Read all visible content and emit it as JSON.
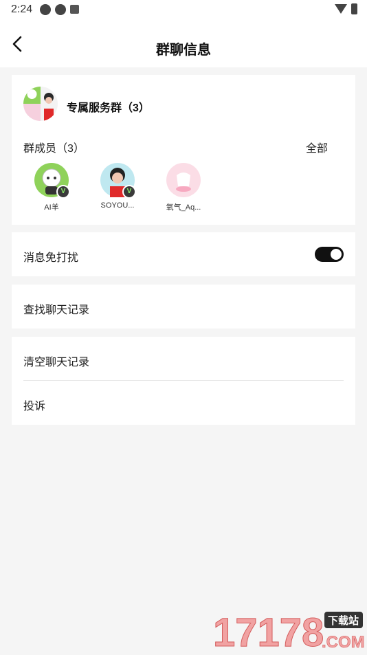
{
  "status_bar": {
    "time": "2:24"
  },
  "nav": {
    "title": "群聊信息"
  },
  "group": {
    "name": "专属服务群（3）",
    "members_label": "群成员（3）",
    "all_label": "全部",
    "members": [
      {
        "name": "AI羊",
        "badge": "V"
      },
      {
        "name": "SOYOU...",
        "badge": "V"
      },
      {
        "name": "氧气_Aq..."
      }
    ]
  },
  "settings": {
    "mute_label": "消息免打扰",
    "mute_on": true,
    "search_history_label": "查找聊天记录",
    "clear_history_label": "清空聊天记录",
    "report_label": "投诉"
  },
  "watermark": {
    "number": "17178",
    "badge": "下载站",
    "suffix": ".COM"
  },
  "colors": {
    "background": "#f5f5f5",
    "card": "#ffffff",
    "toggle_on": "#111111",
    "badge_green": "#8df06a"
  }
}
